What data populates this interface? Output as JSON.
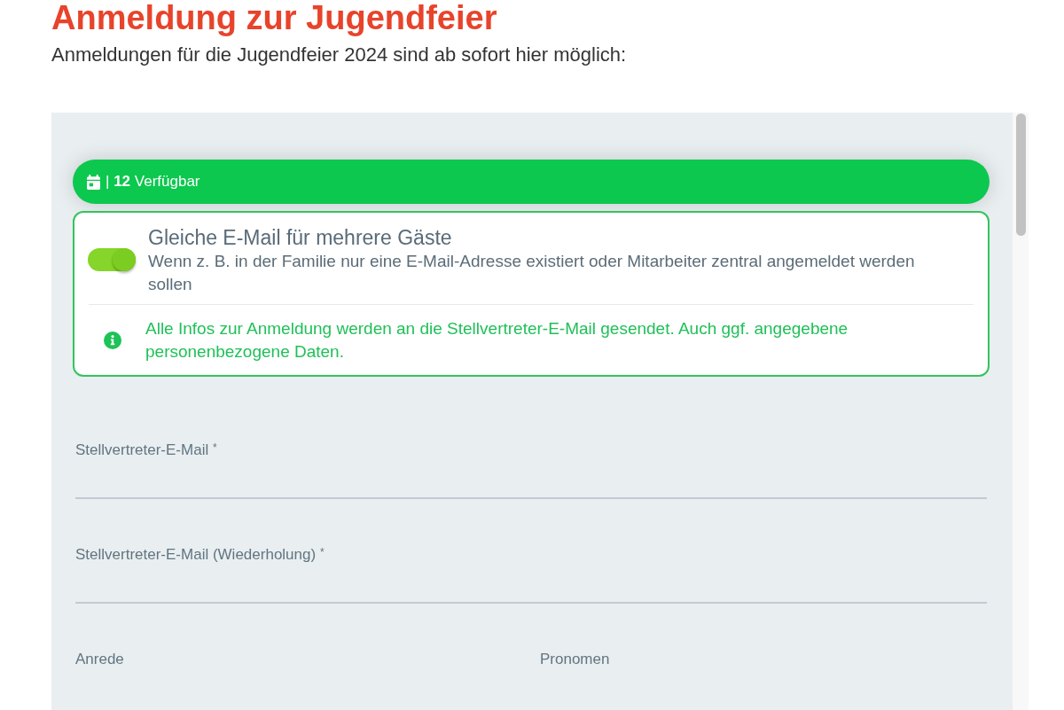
{
  "heading": "Anmeldung zur Jugendfeier",
  "intro": "Anmeldungen für die Jugendfeier 2024 sind ab sofort hier möglich:",
  "form": {
    "availability": {
      "text": "| **12** Verfügbar"
    },
    "shared_email_option": {
      "on": true,
      "title": "Gleiche E-Mail für mehrere Gäste",
      "description": "Wenn z. B. in der Familie nur eine E-Mail-Adresse existiert oder Mitarbeiter zentral angemeldet werden sollen",
      "info": "Alle Infos zur Anmeldung werden an die Stellvertreter-E-Mail gesendet. Auch ggf. angegebene personenbezogene Daten."
    },
    "fields": [
      {
        "label": "Stellvertreter-E-Mail $^{*}$"
      },
      {
        "label": "Stellvertreter-E-Mail (Wiederholung) $^{*}$"
      }
    ],
    "field_row": [
      {
        "label": "Anrede"
      },
      {
        "label": "Pronomen"
      }
    ]
  }
}
